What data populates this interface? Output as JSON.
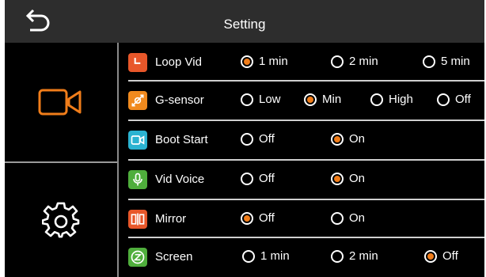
{
  "header": {
    "title": "Setting",
    "back_icon": "back-arrow-icon"
  },
  "sidebar": {
    "items": [
      {
        "name": "video-camera-icon",
        "selected": true,
        "color": "#f07d1a"
      },
      {
        "name": "gear-icon",
        "selected": false,
        "color": "#ffffff"
      }
    ]
  },
  "colors": {
    "accent": "#f07d1a",
    "header_bg": "#2d2d2d",
    "background": "#000000"
  },
  "settings": [
    {
      "label": "Loop Vid",
      "icon": "loop-video-icon",
      "icon_color": "#e8572a",
      "options": [
        {
          "label": "1 min",
          "selected": true
        },
        {
          "label": "2 min",
          "selected": false
        },
        {
          "label": "5 min",
          "selected": false
        }
      ]
    },
    {
      "label": "G-sensor",
      "icon": "g-sensor-icon",
      "icon_color": "#f08a1e",
      "options": [
        {
          "label": "Low",
          "selected": false
        },
        {
          "label": "Min",
          "selected": true
        },
        {
          "label": "High",
          "selected": false
        },
        {
          "label": "Off",
          "selected": false
        }
      ]
    },
    {
      "label": "Boot Start",
      "icon": "boot-start-icon",
      "icon_color": "#2bb3d1",
      "options": [
        {
          "label": "Off",
          "selected": false
        },
        {
          "label": "On",
          "selected": true
        }
      ]
    },
    {
      "label": "Vid Voice",
      "icon": "microphone-icon",
      "icon_color": "#4fae3c",
      "options": [
        {
          "label": "Off",
          "selected": false
        },
        {
          "label": "On",
          "selected": true
        }
      ]
    },
    {
      "label": "Mirror",
      "icon": "mirror-icon",
      "icon_color": "#e8572a",
      "options": [
        {
          "label": "Off",
          "selected": true
        },
        {
          "label": "On",
          "selected": false
        }
      ]
    },
    {
      "label": "Screen",
      "icon": "screen-timeout-icon",
      "icon_color": "#4fae3c",
      "options": [
        {
          "label": "1 min",
          "selected": false
        },
        {
          "label": "2 min",
          "selected": false
        },
        {
          "label": "Off",
          "selected": true
        }
      ]
    }
  ]
}
